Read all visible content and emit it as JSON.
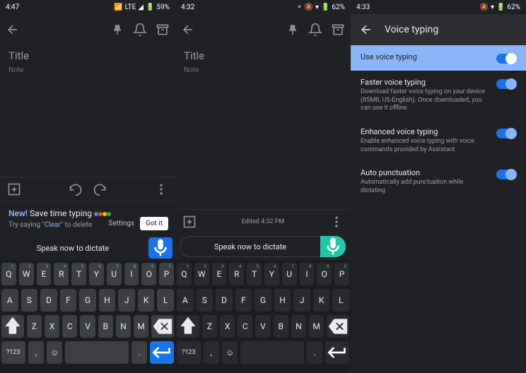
{
  "screen1": {
    "status": {
      "time": "4:47",
      "network": "LTE",
      "battery": "59%"
    },
    "note": {
      "title": "Title",
      "body": "Note"
    },
    "promo": {
      "new": "New!",
      "text": "Save time typing",
      "sub_prefix": "Try saying \"",
      "sub_word": "Clear",
      "sub_suffix": "\" to delete",
      "settings": "Settings",
      "gotit": "Got it"
    },
    "speak": "Speak now to dictate",
    "keys": {
      "row1": [
        "Q",
        "W",
        "E",
        "R",
        "T",
        "Y",
        "U",
        "I",
        "O",
        "P"
      ],
      "row2": [
        "A",
        "S",
        "D",
        "F",
        "G",
        "H",
        "J",
        "K",
        "L"
      ],
      "row3": [
        "Z",
        "X",
        "C",
        "V",
        "B",
        "N",
        "M"
      ],
      "sym": "?123"
    }
  },
  "screen2": {
    "status": {
      "time": "4:32",
      "battery": "62%"
    },
    "note": {
      "title": "Title",
      "body": "Note"
    },
    "edited": "Edited 4:32 PM",
    "speak": "Speak now to dictate",
    "keys": {
      "row1": [
        "Q",
        "W",
        "E",
        "R",
        "T",
        "Y",
        "U",
        "I",
        "O",
        "P"
      ],
      "row2": [
        "A",
        "S",
        "D",
        "F",
        "G",
        "H",
        "J",
        "K",
        "L"
      ],
      "row3": [
        "Z",
        "X",
        "C",
        "V",
        "B",
        "N",
        "M"
      ],
      "sym": "?123"
    }
  },
  "screen3": {
    "status": {
      "time": "4:33",
      "battery": "62%"
    },
    "header": "Voice typing",
    "items": [
      {
        "title": "Use voice typing",
        "desc": ""
      },
      {
        "title": "Faster voice typing",
        "desc": "Download faster voice typing on your device (85MB, US-English). Once downloaded, you can use it offline"
      },
      {
        "title": "Enhanced voice typing",
        "desc": "Enable enhanced voice typing with voice commands provided by Assistant"
      },
      {
        "title": "Auto punctuation",
        "desc": "Automatically add punctuation while dictating"
      }
    ]
  }
}
